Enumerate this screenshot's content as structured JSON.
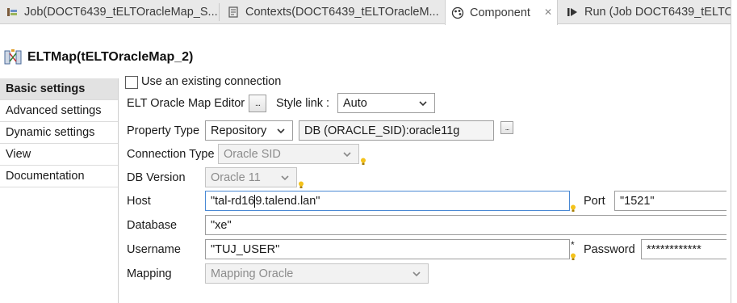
{
  "tabs": [
    {
      "label": "Job(DOCT6439_tELTOracleMap_S...",
      "icon": "job-icon"
    },
    {
      "label": "Contexts(DOCT6439_tELTOracleM...",
      "icon": "contexts-icon"
    },
    {
      "label": "Component",
      "icon": "component-icon"
    },
    {
      "label": "Run (Job DOCT6439_tELTO",
      "icon": "run-icon"
    }
  ],
  "component_title": "ELTMap(tELTOracleMap_2)",
  "nav": [
    {
      "label": "Basic settings",
      "active": true
    },
    {
      "label": "Advanced settings",
      "active": false
    },
    {
      "label": "Dynamic settings",
      "active": false
    },
    {
      "label": "View",
      "active": false
    },
    {
      "label": "Documentation",
      "active": false
    }
  ],
  "form": {
    "use_existing_connection": {
      "label": "Use an existing connection",
      "checked": false
    },
    "map_editor": {
      "label": "ELT Oracle Map Editor",
      "button": "..."
    },
    "style_link": {
      "label": "Style link :",
      "value": "Auto"
    },
    "property_type": {
      "label": "Property Type",
      "value": "Repository",
      "repository_value": "DB (ORACLE_SID):oracle11g",
      "button": "..."
    },
    "connection_type": {
      "label": "Connection Type",
      "value": "Oracle SID"
    },
    "db_version": {
      "label": "DB Version",
      "value": "Oracle 11"
    },
    "host": {
      "label": "Host",
      "value_before_caret": "\"tal-rd16",
      "value_after_caret": "9.talend.lan\""
    },
    "port": {
      "label": "Port",
      "value": "\"1521\""
    },
    "database": {
      "label": "Database",
      "value": "\"xe\""
    },
    "username": {
      "label": "Username",
      "value": "\"TUJ_USER\"",
      "required_mark": "*"
    },
    "password": {
      "label": "Password",
      "value": "************"
    },
    "mapping": {
      "label": "Mapping",
      "value": "Mapping Oracle"
    }
  },
  "colors": {
    "focus_border": "#4a89d4",
    "nav_active_bg": "#e2e2e2",
    "tabbar_bg": "#e9e9e9"
  }
}
